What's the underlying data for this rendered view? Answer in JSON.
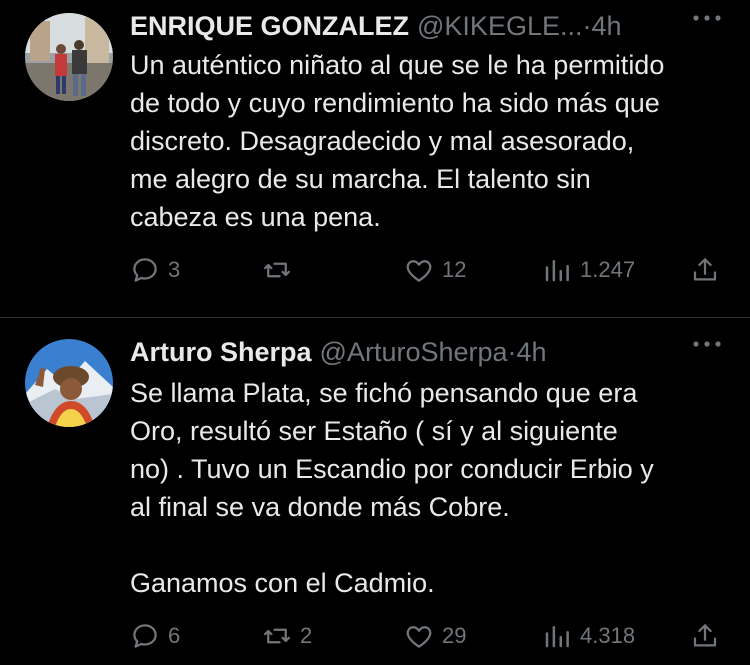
{
  "tweets": [
    {
      "name": "ENRIQUE GONZALEZ",
      "handle": "@KIKEGLE...",
      "separator": "·",
      "time": "4h",
      "text": "Un auténtico niñato al que se le ha permitido\nde todo y cuyo rendimiento ha sido más que\ndiscreto. Desagradecido y mal asesorado,\nme alegro de su marcha. El talento sin\ncabeza es una pena.",
      "replies": "3",
      "retweets": "",
      "likes": "12",
      "views": "1.247"
    },
    {
      "name": "Arturo Sherpa",
      "handle": "@ArturoSherpa",
      "separator": "·",
      "time": "4h",
      "text": "Se llama Plata, se fichó pensando que era\nOro, resultó ser Estaño ( sí y al siguiente\nno) . Tuvo un Escandio por conducir Erbio y\nal final se va donde más Cobre.\n\nGanamos con el Cadmio.",
      "replies": "6",
      "retweets": "2",
      "likes": "29",
      "views": "4.318"
    }
  ],
  "colors": {
    "background": "#000000",
    "text": "#e7e9ea",
    "muted": "#71767b",
    "divider": "#2f3336"
  },
  "icons": [
    "reply-icon",
    "retweet-icon",
    "like-icon",
    "views-icon",
    "share-icon",
    "more-icon"
  ]
}
